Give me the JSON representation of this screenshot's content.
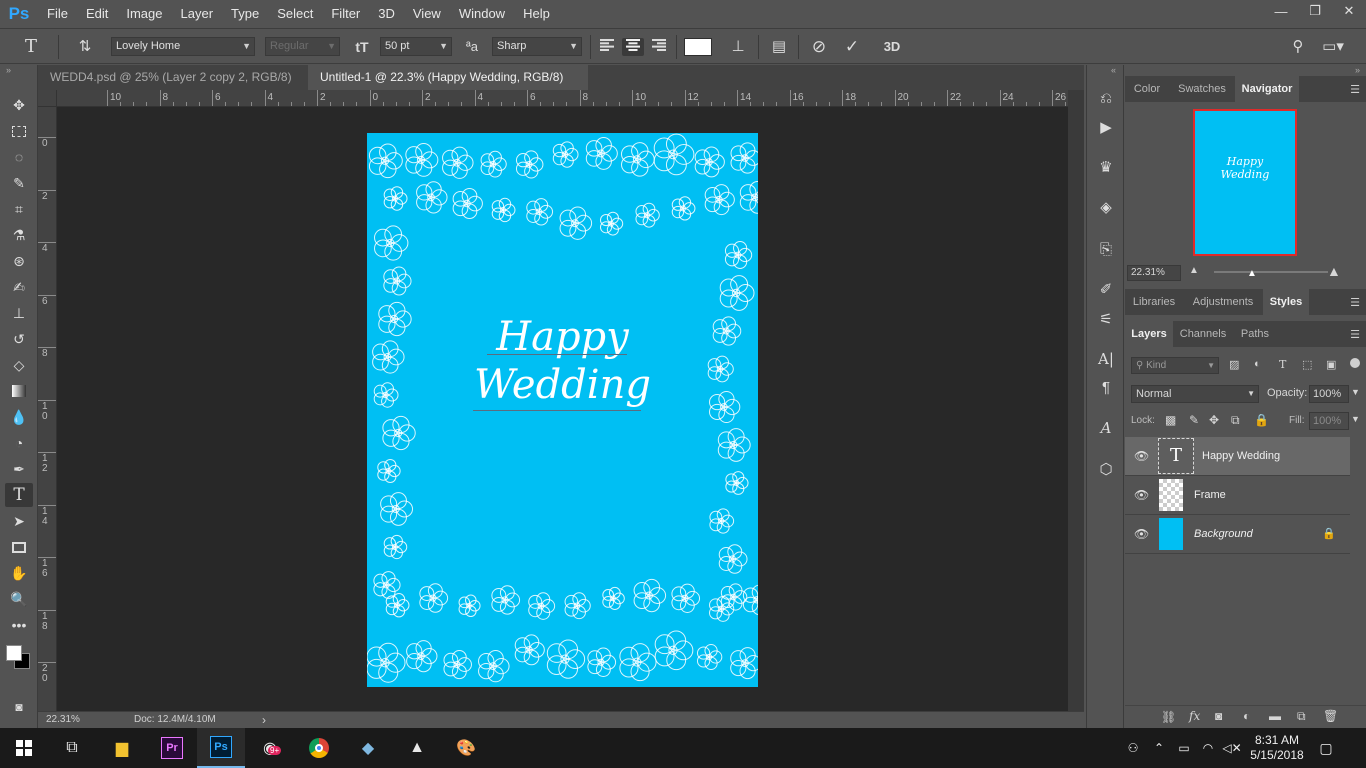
{
  "app": {
    "logo": "Ps",
    "accent": "#31a8ff"
  },
  "menu": [
    "File",
    "Edit",
    "Image",
    "Layer",
    "Type",
    "Select",
    "Filter",
    "3D",
    "View",
    "Window",
    "Help"
  ],
  "window_controls": {
    "minimize": "—",
    "restore": "❐",
    "close": "✕"
  },
  "options": {
    "tool_icon": "type-tool-icon",
    "orientation_icon": "toggle-orientation-icon",
    "font_family": "Lovely Home",
    "font_style": "Regular",
    "size_icon": "font-size-icon",
    "font_size": "50 pt",
    "aa_icon": "anti-alias-icon",
    "anti_alias": "Sharp",
    "text_color": "#ffffff",
    "cancel_icon": "⃠",
    "commit_icon": "✓",
    "three_d": "3D"
  },
  "tabs": [
    {
      "label": "WEDD4.psd @ 25% (Layer 2 copy 2, RGB/8) *",
      "close": "✕",
      "active": false
    },
    {
      "label": "Untitled-1 @ 22.3% (Happy Wedding, RGB/8) *",
      "close": "✕",
      "active": true
    }
  ],
  "ruler": {
    "horizontal": [
      "10",
      "8",
      "6",
      "4",
      "2",
      "0",
      "2",
      "4",
      "6",
      "8",
      "10",
      "12",
      "14",
      "16",
      "18",
      "20",
      "22",
      "24",
      "26"
    ],
    "vertical": [
      "0",
      "2",
      "4",
      "6",
      "8",
      "10",
      "12",
      "14",
      "16",
      "18",
      "20"
    ]
  },
  "document": {
    "background": "#00bff3",
    "text_line1": "Happy",
    "text_line2": "Wedding"
  },
  "status": {
    "zoom": "22.31%",
    "doc": "Doc: 12.4M/4.10M",
    "arrow": "›"
  },
  "navigator": {
    "tabs": [
      "Color",
      "Swatches",
      "Navigator"
    ],
    "active": "Navigator",
    "zoom": "22.31%",
    "thumb_line1": "Happy",
    "thumb_line2": "Wedding"
  },
  "styles_panel": {
    "tabs": [
      "Libraries",
      "Adjustments",
      "Styles"
    ],
    "active": "Styles"
  },
  "layers_panel": {
    "tabs": [
      "Layers",
      "Channels",
      "Paths"
    ],
    "active": "Layers",
    "filter": "Kind",
    "blend_mode": "Normal",
    "opacity_label": "Opacity:",
    "opacity": "100%",
    "lock_label": "Lock:",
    "fill_label": "Fill:",
    "fill": "100%",
    "layers": [
      {
        "name": "Happy Wedding",
        "type": "text",
        "selected": true
      },
      {
        "name": "Frame",
        "type": "transparent",
        "selected": false
      },
      {
        "name": "Background",
        "type": "fill",
        "color": "#00bff3",
        "locked": true,
        "selected": false
      }
    ],
    "footer_icons": [
      "link-icon",
      "fx-icon",
      "mask-icon",
      "adjustment-icon",
      "folder-icon",
      "new-layer-icon",
      "trash-icon"
    ]
  },
  "taskbar": {
    "time": "8:31 AM",
    "date": "5/15/2018",
    "badge": "9+"
  }
}
